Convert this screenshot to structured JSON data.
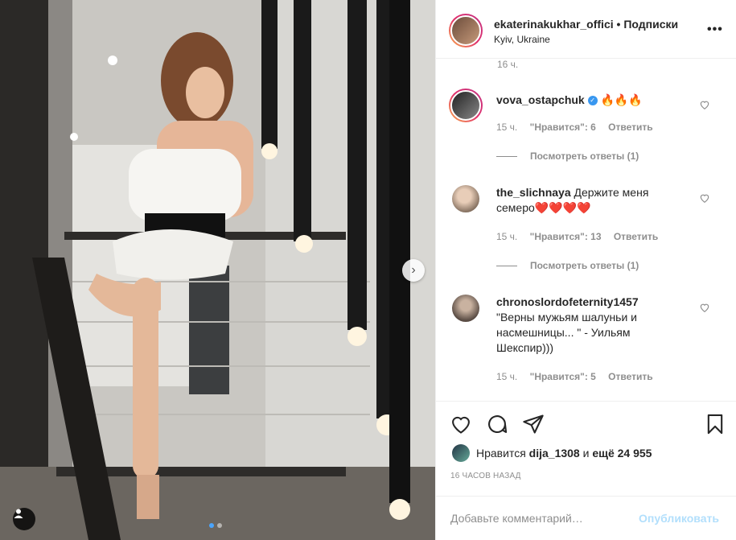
{
  "post": {
    "username": "ekaterinakukhar_offici",
    "separator": "•",
    "follow_label": "Подписки",
    "location": "Kyiv, Ukraine",
    "more_icon": "more-horizontal-icon",
    "more_glyph": "•••"
  },
  "comments": {
    "cut_time": "16 ч.",
    "items": [
      {
        "username": "vova_ostapchuk",
        "verified": true,
        "text": "🔥🔥🔥",
        "time": "15 ч.",
        "likes": "\"Нравится\": 6",
        "reply": "Ответить",
        "view_replies": "Посмотреть ответы (1)"
      },
      {
        "username": "the_slichnaya",
        "verified": false,
        "text": "Держите меня семеро❤️❤️❤️❤️",
        "time": "15 ч.",
        "likes": "\"Нравится\": 13",
        "reply": "Ответить",
        "view_replies": "Посмотреть ответы (1)"
      },
      {
        "username": "chronoslordofeternity1457",
        "verified": false,
        "text": "\"Верны мужьям шалуньи и насмешницы... \" - Уильям Шекспир)))",
        "time": "15 ч.",
        "likes": "\"Нравится\": 5",
        "reply": "Ответить"
      }
    ]
  },
  "actions": {
    "like_icon": "heart-icon",
    "comment_icon": "comment-icon",
    "share_icon": "share-icon",
    "save_icon": "bookmark-icon"
  },
  "likes": {
    "prefix": "Нравится",
    "user": "dija_1308",
    "conj": "и",
    "others": "ещё 24 955"
  },
  "posted_ago": "16 ЧАСОВ НАЗАД",
  "add_comment": {
    "placeholder": "Добавьте комментарий…",
    "publish_label": "Опубликовать"
  },
  "carousel": {
    "next_glyph": "›",
    "slides_total": 2,
    "active_slide": 1
  },
  "colors": {
    "accent": "#3897f0",
    "publish_disabled": "#b2dffc",
    "muted": "#8e8e8e"
  }
}
